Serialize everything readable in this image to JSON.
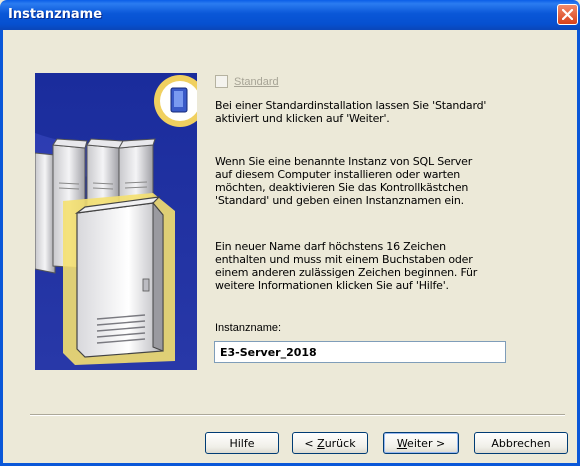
{
  "window": {
    "title": "Instanzname"
  },
  "checkbox": {
    "label": "Standard",
    "checked": false,
    "disabled": true
  },
  "paragraphs": [
    [
      "Bei einer Standardinstallation lassen Sie 'Standard'",
      "aktiviert und klicken auf 'Weiter'."
    ],
    [
      "Wenn Sie eine benannte Instanz von SQL Server",
      "auf diesem Computer installieren oder warten",
      "möchten, deaktivieren Sie das Kontrollkästchen",
      "'Standard' und geben einen Instanznamen ein."
    ],
    [
      "Ein neuer Name darf höchstens 16 Zeichen",
      "enthalten und muss mit einem Buchstaben oder",
      "einem anderen zulässigen Zeichen beginnen. Für",
      "weitere Informationen klicken Sie auf 'Hilfe'."
    ]
  ],
  "field": {
    "label": "Instanzname:",
    "value": "E3-Server_2018"
  },
  "buttons": {
    "help": "Hilfe",
    "back_prefix": "< ",
    "back_underlined": "Z",
    "back_rest": "urück",
    "next_underlined": "W",
    "next_rest": "eiter >",
    "cancel": "Abbrechen"
  },
  "icons": [
    "close-icon",
    "server-artwork",
    "book-icon",
    "checkbox-icon"
  ],
  "colors": {
    "titlebar": "#0a57d8",
    "dialog_bg": "#ece9d8",
    "close_button": "#d8401a"
  }
}
